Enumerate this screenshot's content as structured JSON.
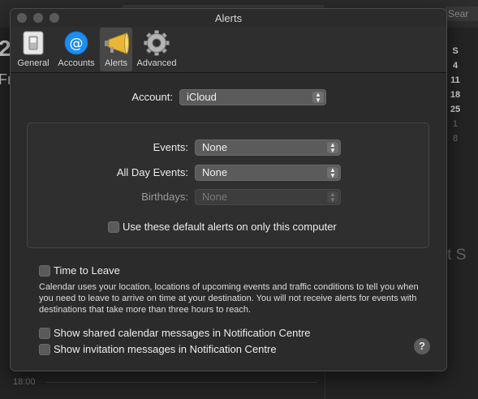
{
  "background": {
    "search_placeholder": "Sear",
    "big_number": "2",
    "day_fragment": "Fr",
    "mini_calendar": [
      [
        "S"
      ],
      [
        "4"
      ],
      [
        "11"
      ],
      [
        "18"
      ],
      [
        "25"
      ],
      [
        "1"
      ],
      [
        "8"
      ]
    ],
    "event_fragment": "ent S",
    "time_label": "18:00"
  },
  "window": {
    "title": "Alerts",
    "toolbar": [
      {
        "label": "General",
        "icon": "switch-icon"
      },
      {
        "label": "Accounts",
        "icon": "at-sign-icon"
      },
      {
        "label": "Alerts",
        "icon": "megaphone-icon"
      },
      {
        "label": "Advanced",
        "icon": "gear-icon"
      }
    ],
    "account": {
      "label": "Account:",
      "value": "iCloud"
    },
    "group": {
      "events": {
        "label": "Events:",
        "value": "None"
      },
      "all_day_events": {
        "label": "All Day Events:",
        "value": "None"
      },
      "birthdays": {
        "label": "Birthdays:",
        "value": "None"
      },
      "default_alerts_checkbox": "Use these default alerts on only this computer"
    },
    "time_to_leave": {
      "label": "Time to Leave",
      "description": "Calendar uses your location, locations of upcoming events and traffic conditions to tell you when you need to leave to arrive on time at your destination. You will not receive alerts for events with destinations that take more than three hours to reach."
    },
    "shared_calendar_checkbox": "Show shared calendar messages in Notification Centre",
    "invitation_checkbox": "Show invitation messages in Notification Centre",
    "help": "?"
  },
  "colors": {
    "window_bg": "#2b2b2b",
    "accent_blue": "#1e8ef0",
    "megaphone_yellow": "#e8b73a"
  }
}
